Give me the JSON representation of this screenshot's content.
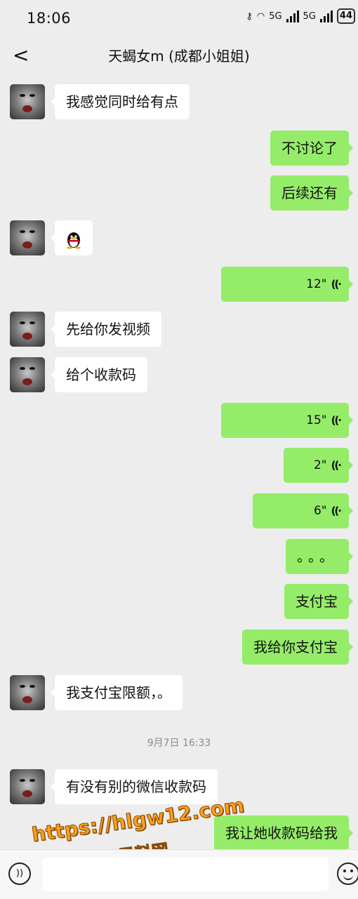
{
  "status": {
    "time": "18:06",
    "net1": "5G",
    "net2": "5G",
    "battery": "44"
  },
  "header": {
    "title": "天蝎女m (成都小姐姐)"
  },
  "messages": [
    {
      "from": "them",
      "text": "我感觉同时给有点"
    },
    {
      "from": "me",
      "text": "不讨论了"
    },
    {
      "from": "me",
      "text": "后续还有"
    },
    {
      "from": "them",
      "sticker": "qq-penguin"
    },
    {
      "from": "me",
      "voice_duration": "12\""
    },
    {
      "from": "them",
      "text": "先给你发视频"
    },
    {
      "from": "them",
      "text": "给个收款码"
    },
    {
      "from": "me",
      "voice_duration": "15\""
    },
    {
      "from": "me",
      "voice_duration": "2\""
    },
    {
      "from": "me",
      "voice_duration": "6\""
    },
    {
      "from": "me",
      "text": "。。。"
    },
    {
      "from": "me",
      "text": "支付宝"
    },
    {
      "from": "me",
      "text": "我给你支付宝"
    },
    {
      "from": "them",
      "text": "我支付宝限额，。"
    },
    {
      "from": "them",
      "text": "有没有别的微信收款码"
    },
    {
      "from": "me",
      "text": "我让她收款码给我"
    }
  ],
  "timestamp": "9月7日 16:33",
  "watermark": {
    "line1": "https://hlgw12.com",
    "line2": "黑料网"
  },
  "colors": {
    "incoming": "#ffffff",
    "outgoing": "#95ec69",
    "background": "#ededed"
  },
  "input": {
    "placeholder": ""
  }
}
